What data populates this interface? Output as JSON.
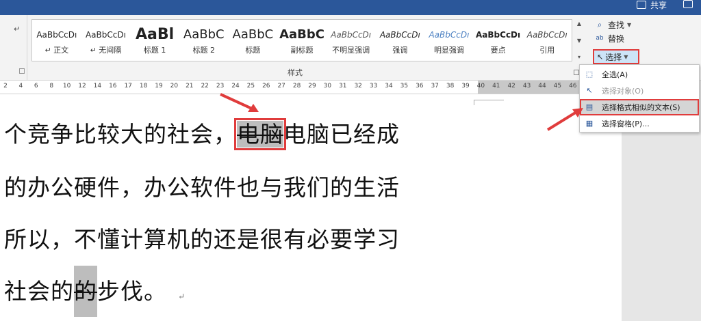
{
  "titlebar": {
    "share_label": "共享"
  },
  "styles_gallery": {
    "group_label": "样式",
    "items": [
      {
        "sample": "AaBbCcDı",
        "name": "↵ 正文"
      },
      {
        "sample": "AaBbCcDı",
        "name": "↵ 无间隔"
      },
      {
        "sample": "AaBl",
        "name": "标题 1"
      },
      {
        "sample": "AaBbC",
        "name": "标题 2"
      },
      {
        "sample": "AaBbC",
        "name": "标题"
      },
      {
        "sample": "AaBbC",
        "name": "副标题"
      },
      {
        "sample": "AaBbCcDı",
        "name": "不明显强调"
      },
      {
        "sample": "AaBbCcDı",
        "name": "强调"
      },
      {
        "sample": "AaBbCcDı",
        "name": "明显强调"
      },
      {
        "sample": "AaBbCcDı",
        "name": "要点"
      },
      {
        "sample": "AaBbCcDı",
        "name": "引用"
      }
    ]
  },
  "editing": {
    "find_label": "查找",
    "replace_label": "替换",
    "select_label": "选择"
  },
  "select_menu": {
    "items": [
      {
        "label": "全选(A)",
        "state": "normal"
      },
      {
        "label": "选择对象(O)",
        "state": "disabled"
      },
      {
        "label": "选择格式相似的文本(S)",
        "state": "active"
      },
      {
        "label": "选择窗格(P)...",
        "state": "normal"
      }
    ]
  },
  "ruler": {
    "ticks": [
      "2",
      "4",
      "6",
      "8",
      "10",
      "12",
      "14",
      "16",
      "17",
      "18",
      "19",
      "20",
      "21",
      "22",
      "23",
      "24",
      "25",
      "26",
      "27",
      "28",
      "29",
      "30",
      "31",
      "32",
      "33",
      "34",
      "35",
      "36",
      "37",
      "38",
      "39",
      "40",
      "41",
      "42",
      "43",
      "44",
      "45",
      "46"
    ]
  },
  "document": {
    "lines": [
      {
        "before": "个竞争比较大的社会，",
        "highlight": "电脑",
        "after": "电脑已经成"
      },
      {
        "before": "的办公硬件，办公软件也与我们的生活",
        "highlight": "",
        "after": ""
      },
      {
        "before": "所以，不懂计算机的还是很有必要学习",
        "highlight": "",
        "after": ""
      },
      {
        "before": "社会的",
        "highlight": "的",
        "after": "步伐。"
      }
    ],
    "paragraph_mark": "↵"
  },
  "colors": {
    "title_bar": "#2b579a",
    "annotation_red": "#e03c3c",
    "selection_gray": "#bdbdbd"
  }
}
